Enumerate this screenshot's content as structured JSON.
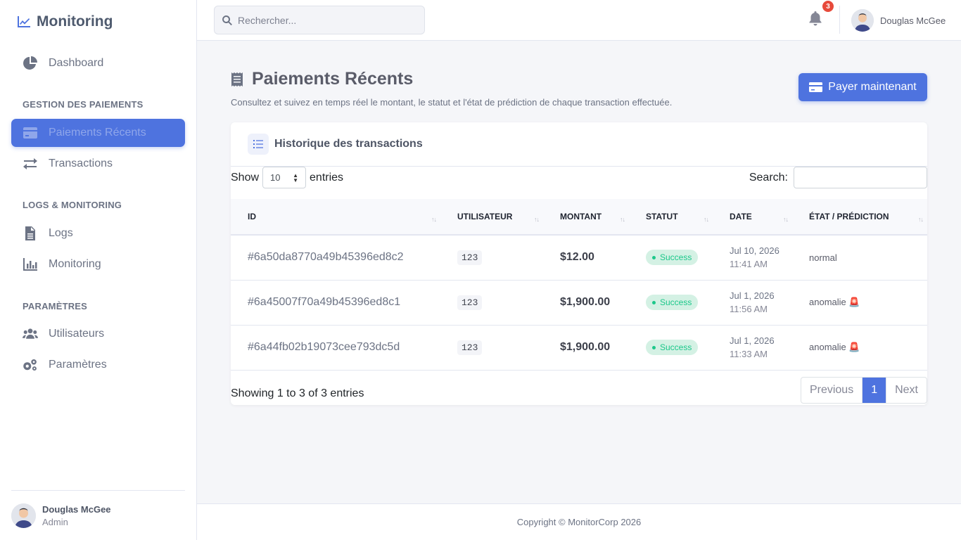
{
  "brand": {
    "name": "Monitoring",
    "icon": "chart-line-icon"
  },
  "sidebar": {
    "items": [
      {
        "label": "Dashboard",
        "icon": "pie-chart-icon"
      },
      {
        "label": "Paiements Récents",
        "icon": "credit-card-icon",
        "active": true
      },
      {
        "label": "Transactions",
        "icon": "exchange-icon"
      },
      {
        "label": "Logs",
        "icon": "file-icon"
      },
      {
        "label": "Monitoring",
        "icon": "bar-chart-icon"
      },
      {
        "label": "Utilisateurs",
        "icon": "users-icon"
      },
      {
        "label": "Paramètres",
        "icon": "gears-icon"
      }
    ],
    "sections": [
      "GESTION DES PAIEMENTS",
      "LOGS & MONITORING",
      "PARAMÈTRES"
    ],
    "user": {
      "name": "Douglas McGee",
      "role": "Admin"
    }
  },
  "topbar": {
    "search_placeholder": "Rechercher...",
    "notifications": "3",
    "user_name": "Douglas McGee"
  },
  "page": {
    "title": "Paiements Récents",
    "subtitle": "Consultez et suivez en temps réel le montant, le statut et l'état de prédiction de chaque transaction effectuée.",
    "pay_button": "Payer maintenant"
  },
  "card": {
    "title": "Historique des transactions",
    "show_label": "Show",
    "entries_value": "10",
    "entries_label": "entries",
    "search_label": "Search:",
    "columns": [
      "ID",
      "UTILISATEUR",
      "MONTANT",
      "STATUT",
      "DATE",
      "ÉTAT / PRÉDICTION"
    ],
    "rows": [
      {
        "id": "#6a50da8770a49b45396ed8c2",
        "user": "123",
        "amount": "$12.00",
        "status": "Success",
        "date": "Jul 10, 2026",
        "time": "11:41 AM",
        "prediction": "normal"
      },
      {
        "id": "#6a45007f70a49b45396ed8c1",
        "user": "123",
        "amount": "$1,900.00",
        "status": "Success",
        "date": "Jul 1, 2026",
        "time": "11:56 AM",
        "prediction": "anomalie 🚨"
      },
      {
        "id": "#6a44fb02b19073cee793dc5d",
        "user": "123",
        "amount": "$1,900.00",
        "status": "Success",
        "date": "Jul 1, 2026",
        "time": "11:33 AM",
        "prediction": "anomalie 🚨"
      }
    ],
    "info": "Showing 1 to 3 of 3 entries",
    "pager": {
      "prev": "Previous",
      "current": "1",
      "next": "Next"
    }
  },
  "footer": {
    "copyright": "Copyright © MonitorCorp 2026"
  },
  "colors": {
    "accent": "#4e73df",
    "success": "#1cc88a",
    "danger": "#e74a3b"
  }
}
